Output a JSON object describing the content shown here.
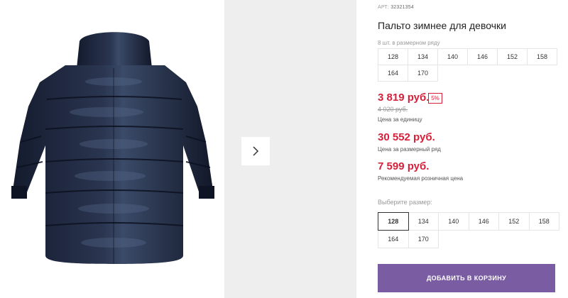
{
  "product": {
    "article_label": "АРТ:",
    "article_value": "32321354",
    "title": "Пальто зимнее для девочки",
    "image_icon": "coat-image"
  },
  "pack": {
    "label": "8 шт. в размерном ряду",
    "sizes": [
      "128",
      "134",
      "140",
      "146",
      "152",
      "158",
      "164",
      "170"
    ]
  },
  "prices": {
    "main": "3 819 руб.",
    "discount": "5%",
    "old": "4 020 руб.",
    "unit_note": "Цена за единицу",
    "pack": "30 552 руб.",
    "pack_note": "Цена за размерный ряд",
    "rrp": "7 599 руб.",
    "rrp_note": "Рекомендуемая розничная цена",
    "accent_color": "#d5203a"
  },
  "size_picker": {
    "label": "Выберите размер:",
    "sizes": [
      "128",
      "134",
      "140",
      "146",
      "152",
      "158",
      "164",
      "170"
    ],
    "selected": "128"
  },
  "cart": {
    "button_label": "ДОБАВИТЬ В КОРЗИНУ",
    "button_color": "#7a5ca3"
  },
  "gallery": {
    "next_icon": "chevron-right-icon"
  }
}
